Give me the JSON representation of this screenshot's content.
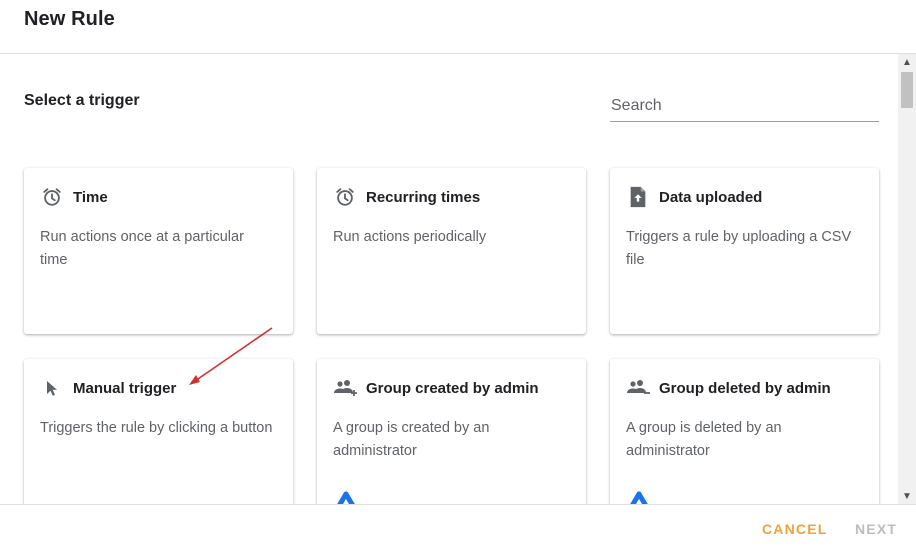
{
  "dialog": {
    "title": "New Rule"
  },
  "trigger_section": {
    "title": "Select a trigger",
    "search_placeholder": "Search"
  },
  "cards": [
    {
      "title": "Time",
      "description": "Run actions once at a particular time",
      "icon": "alarm-icon"
    },
    {
      "title": "Recurring times",
      "description": "Run actions periodically",
      "icon": "alarm-icon"
    },
    {
      "title": "Data uploaded",
      "description": "Triggers a rule by uploading a CSV file",
      "icon": "file-upload-icon"
    },
    {
      "title": "Manual trigger",
      "description": "Triggers the rule by clicking a button",
      "icon": "cursor-click-icon"
    },
    {
      "title": "Group created by admin",
      "description": "A group is created by an administrator",
      "icon": "group-add-icon"
    },
    {
      "title": "Group deleted by admin",
      "description": "A group is deleted by an administrator",
      "icon": "group-remove-icon"
    }
  ],
  "footer": {
    "cancel_label": "CANCEL",
    "next_label": "NEXT"
  },
  "colors": {
    "accent": "#f0a23b",
    "disabled": "#bdbdbd",
    "annotation_arrow": "#d32f2f",
    "icon": "#5f6368",
    "workspace_blue": "#1a73e8"
  }
}
